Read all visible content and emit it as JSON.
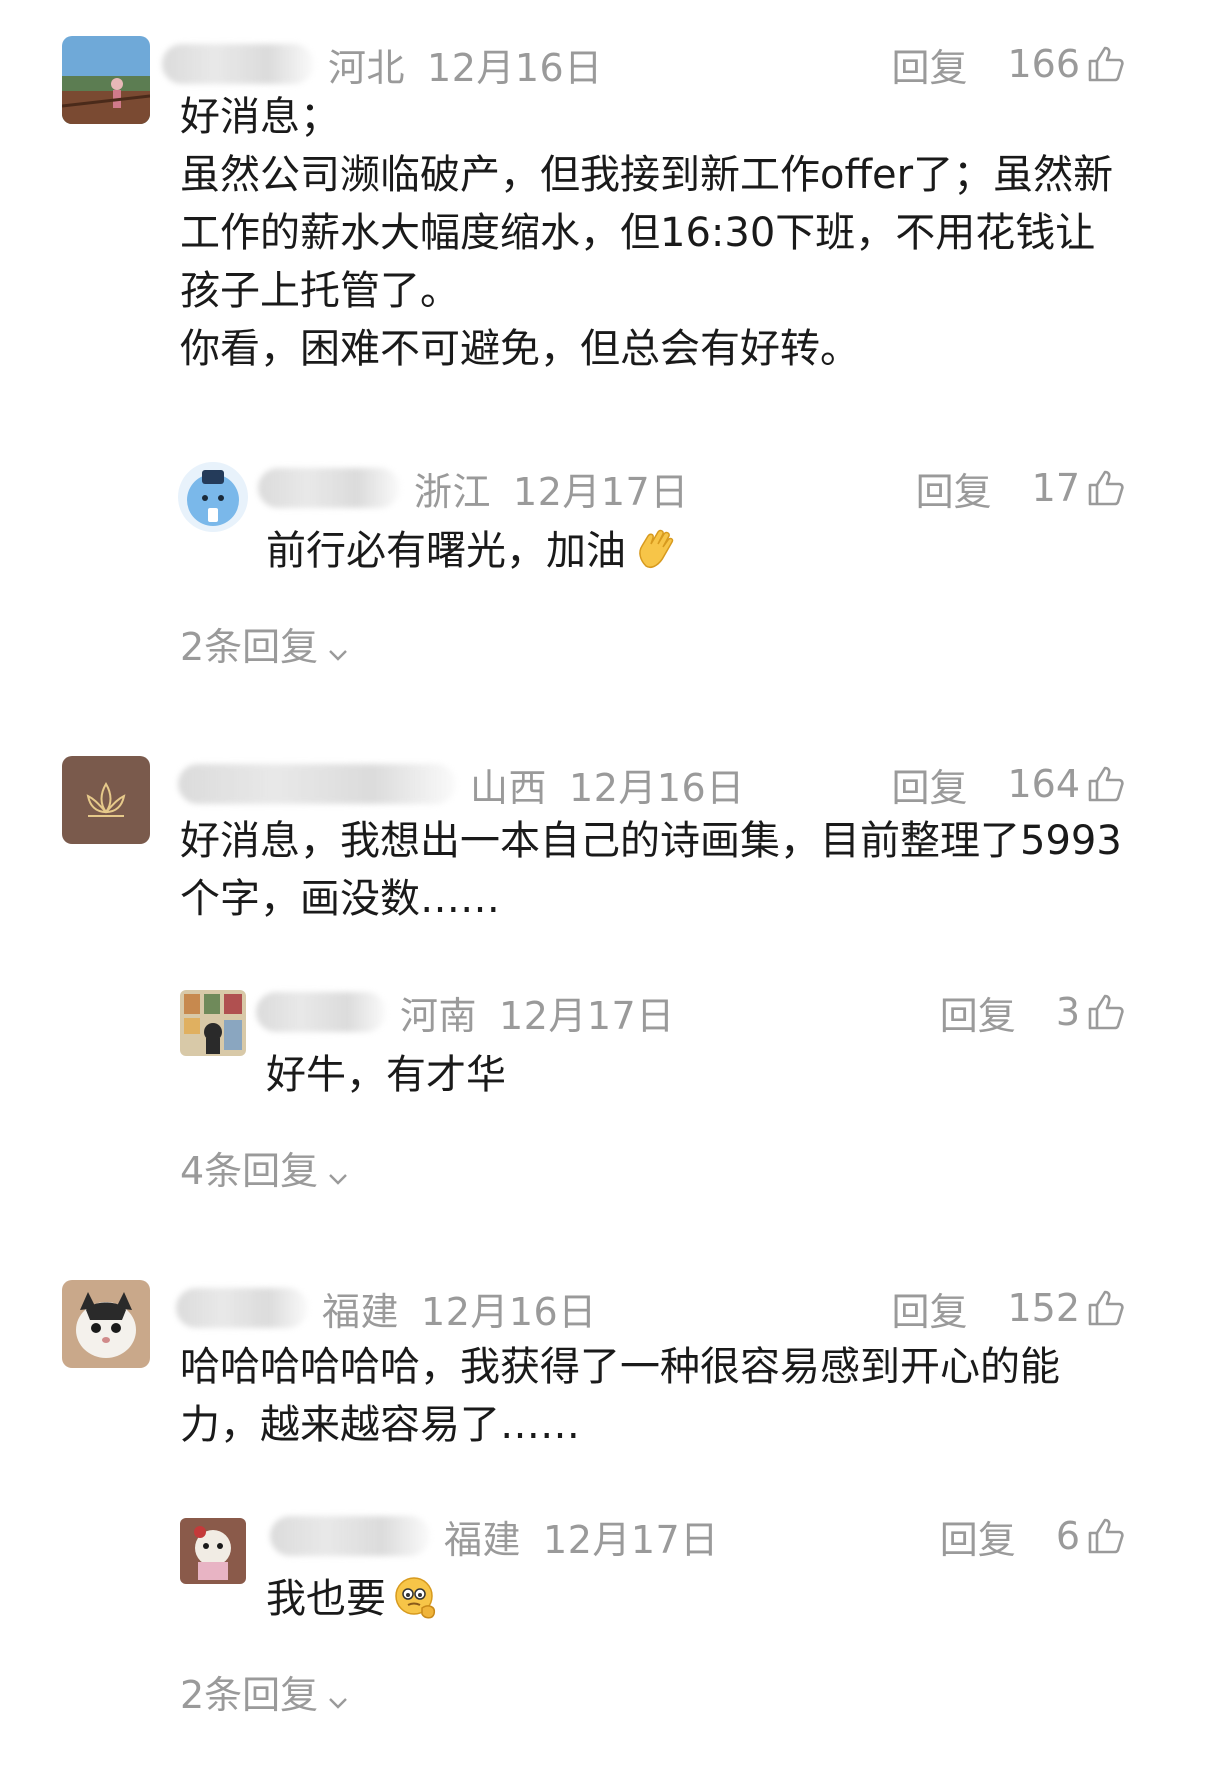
{
  "comments": [
    {
      "location": "河北",
      "date": "12月16日",
      "reply_label": "回复",
      "likes": "166",
      "body": [
        "好消息；",
        "虽然公司濒临破产，但我接到新工作offer了；虽然新工作的薪水大幅度缩水，但16:30下班，不用花钱让孩子上托管了。",
        "你看，困难不可避免，但总会有好转。"
      ],
      "reply": {
        "location": "浙江",
        "date": "12月17日",
        "reply_label": "回复",
        "likes": "17",
        "body": "前行必有曙光，加油",
        "emoji": "waving-hand-emoji"
      },
      "more_replies": "2条回复"
    },
    {
      "location": "山西",
      "date": "12月16日",
      "reply_label": "回复",
      "likes": "164",
      "body": [
        "好消息，我想出一本自己的诗画集，目前整理了5993个字，画没数……"
      ],
      "reply": {
        "location": "河南",
        "date": "12月17日",
        "reply_label": "回复",
        "likes": "3",
        "body": "好牛，有才华"
      },
      "more_replies": "4条回复"
    },
    {
      "location": "福建",
      "date": "12月16日",
      "reply_label": "回复",
      "likes": "152",
      "body": [
        "哈哈哈哈哈哈，我获得了一种很容易感到开心的能力，越来越容易了……"
      ],
      "reply": {
        "location": "福建",
        "date": "12月17日",
        "reply_label": "回复",
        "likes": "6",
        "body": "我也要",
        "emoji": "thinking-face-emoji"
      },
      "more_replies": "2条回复"
    }
  ],
  "colors": {
    "text": "#1a1a1a",
    "meta": "#9a9a9a",
    "background": "#ffffff"
  }
}
